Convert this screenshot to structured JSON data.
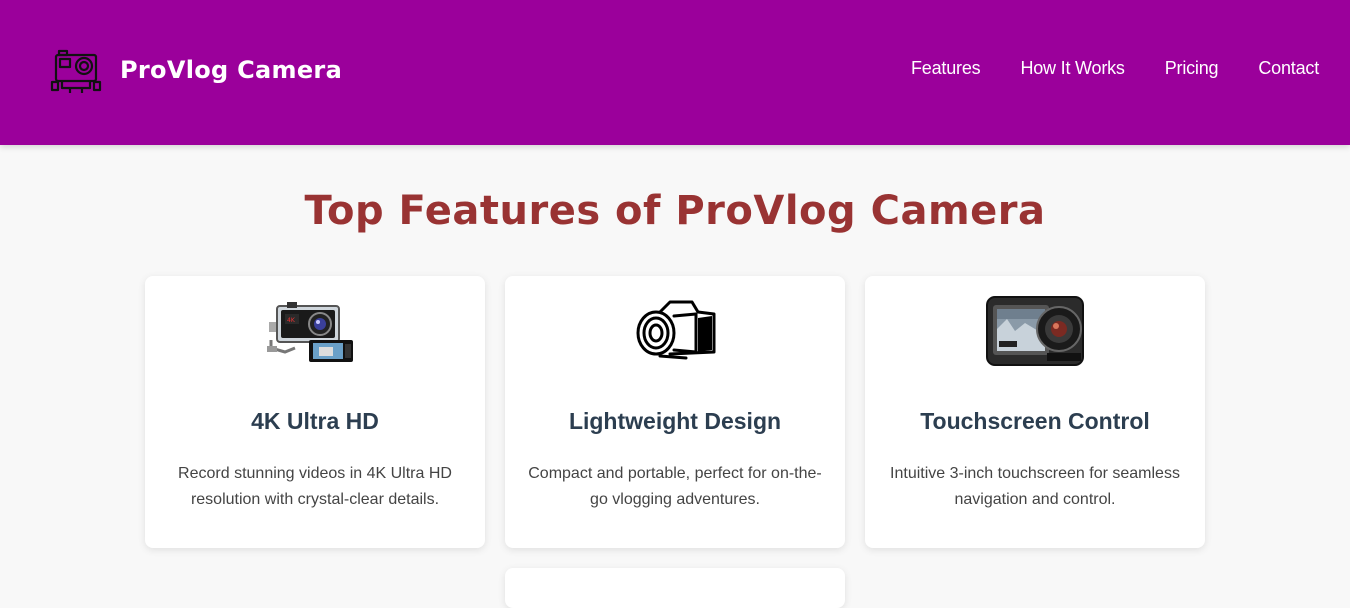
{
  "brand": {
    "name": "ProVlog Camera",
    "logo_icon": "action-camera-icon"
  },
  "nav": {
    "items": [
      {
        "label": "Features"
      },
      {
        "label": "How It Works"
      },
      {
        "label": "Pricing"
      },
      {
        "label": "Contact"
      }
    ]
  },
  "features": {
    "title": "Top Features of ProVlog Camera",
    "cards": [
      {
        "icon": "action-camera-kit-image",
        "title": "4K Ultra HD",
        "description": "Record stunning videos in 4K Ultra HD resolution with crystal-clear details."
      },
      {
        "icon": "camera-sketch-icon",
        "title": "Lightweight Design",
        "description": "Compact and portable, perfect for on-the-go vlogging adventures."
      },
      {
        "icon": "touchscreen-camera-image",
        "title": "Touchscreen Control",
        "description": "Intuitive 3-inch touchscreen for seamless navigation and control."
      }
    ]
  },
  "colors": {
    "header_bg": "#9b009b",
    "title": "#993333",
    "card_title": "#2c3e50",
    "page_bg": "#f8f8f8"
  }
}
